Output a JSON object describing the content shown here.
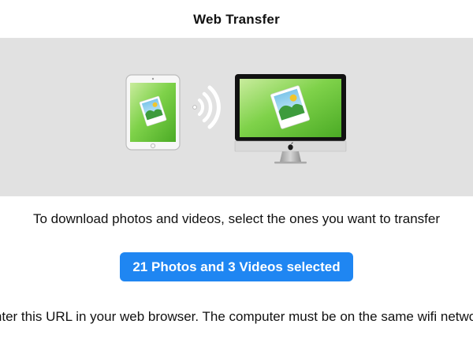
{
  "navbar": {
    "title": "Web Transfer"
  },
  "hero": {
    "tablet_icon": "tablet-photo-icon",
    "wifi_icon": "wifi-signal-icon",
    "computer_icon": "computer-photo-icon"
  },
  "main": {
    "instruction": "To download photos and videos, select the ones you want to transfer",
    "select_button_label": "21 Photos and 3 Videos selected",
    "url_instruction": "Enter this URL in your web browser. The computer must be on the same wifi network"
  },
  "colors": {
    "accent": "#1f86f2",
    "hero_background": "#e1e1e1",
    "photo_green": "#5cbf2f"
  }
}
